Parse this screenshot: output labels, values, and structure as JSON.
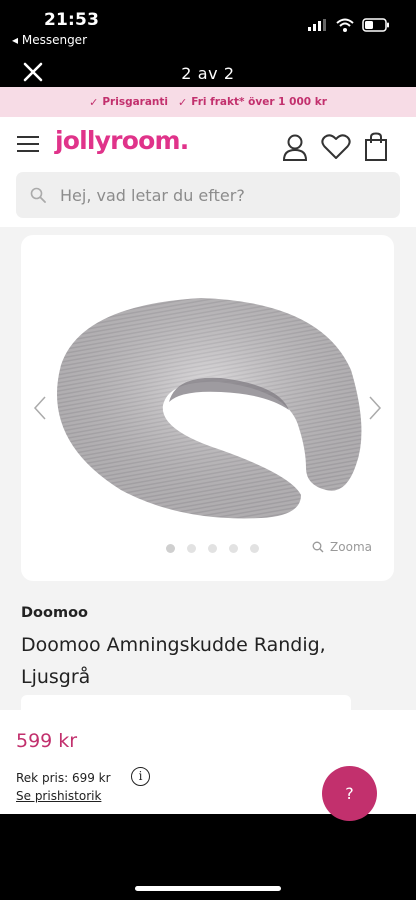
{
  "statusbar": {
    "time": "21:53",
    "back_app": "◂ Messenger",
    "icons": [
      "signal-icon",
      "wifi-icon",
      "battery-icon"
    ]
  },
  "viewer": {
    "close_icon": "close-icon",
    "counter": "2 av 2"
  },
  "promo": {
    "items": [
      {
        "label": "Prisgaranti",
        "icon": "check-icon"
      },
      {
        "label": "Fri frakt* över 1 000 kr",
        "icon": "check-icon"
      }
    ]
  },
  "header": {
    "logo": "jollyroom.",
    "icons": [
      "menu-icon",
      "account-icon",
      "wishlist-heart-icon",
      "cart-bag-icon"
    ],
    "search_placeholder": "Hej, vad letar du efter?"
  },
  "product": {
    "brand": "Doomoo",
    "title": "Doomoo Amningskudde Randig, Ljusgrå",
    "image_count": 5,
    "active_image_index": 0,
    "zoom_label": "Zooma",
    "price": "599 kr",
    "rek_price": "Rek pris: 699 kr",
    "history_link": "Se prishistorik",
    "help_label": "?"
  },
  "colors": {
    "brand_pink": "#e0338a",
    "price_pink": "#c2306d",
    "promo_bg": "#f7dce6"
  }
}
